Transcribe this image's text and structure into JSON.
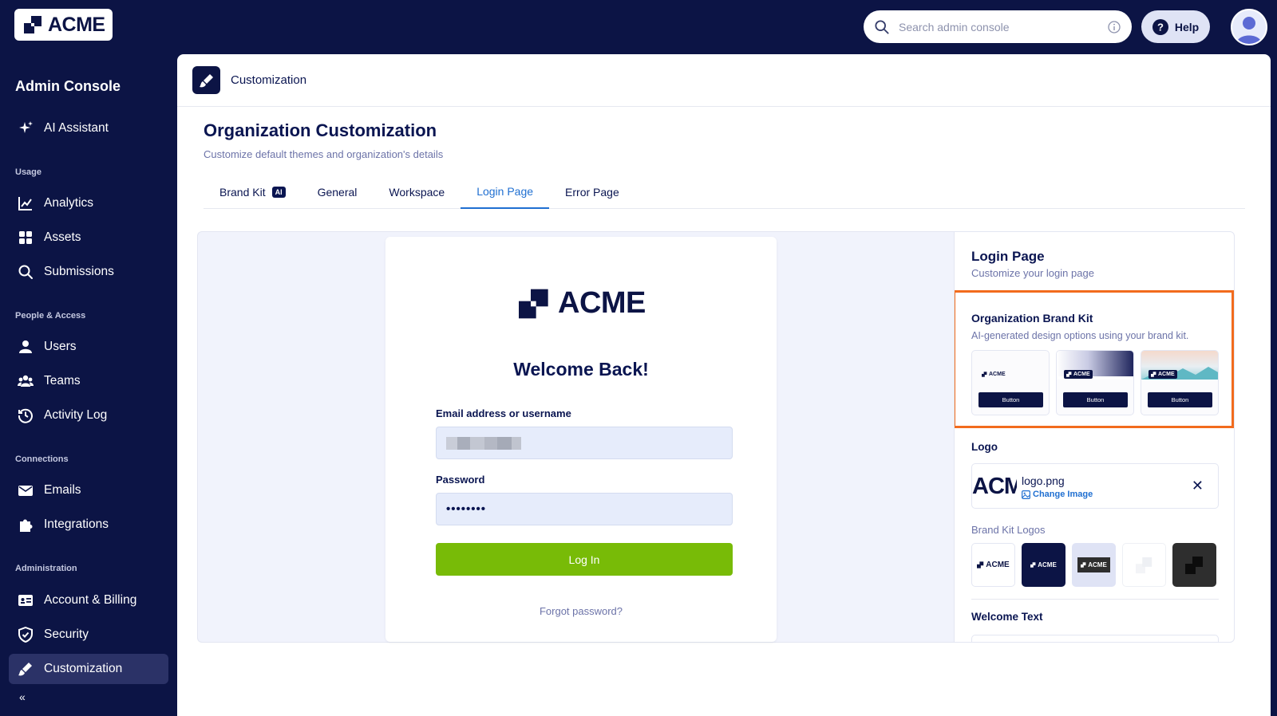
{
  "topbar": {
    "logo_text": "ACME",
    "search_placeholder": "Search admin console",
    "help_label": "Help"
  },
  "sidebar": {
    "title": "Admin Console",
    "assistant": "AI Assistant",
    "sections": {
      "usage": "Usage",
      "people": "People & Access",
      "connections": "Connections",
      "administration": "Administration"
    },
    "items": {
      "analytics": "Analytics",
      "assets": "Assets",
      "submissions": "Submissions",
      "users": "Users",
      "teams": "Teams",
      "activity_log": "Activity Log",
      "emails": "Emails",
      "integrations": "Integrations",
      "account_billing": "Account & Billing",
      "security": "Security",
      "customization": "Customization"
    }
  },
  "header": {
    "title": "Customization"
  },
  "page": {
    "title": "Organization Customization",
    "subtitle": "Customize default themes and organization's details"
  },
  "tabs": [
    {
      "label": "Brand Kit",
      "badge": "AI"
    },
    {
      "label": "General"
    },
    {
      "label": "Workspace"
    },
    {
      "label": "Login Page",
      "active": true
    },
    {
      "label": "Error Page"
    }
  ],
  "preview": {
    "logo_text": "ACME",
    "welcome": "Welcome Back!",
    "email_label": "Email address or username",
    "password_label": "Password",
    "password_value": "••••••••",
    "login_button": "Log In",
    "forgot": "Forgot password?"
  },
  "settings": {
    "title": "Login Page",
    "subtitle": "Customize your login page",
    "brand_kit": {
      "title": "Organization Brand Kit",
      "subtitle": "AI-generated design options using your brand kit.",
      "mini_logo": "ACME",
      "button_label": "Button"
    },
    "logo": {
      "label": "Logo",
      "thumb_text": "ACME",
      "filename": "logo.png",
      "change": "Change Image"
    },
    "brand_kit_logos_label": "Brand Kit Logos",
    "brand_kit_logo_text": "ACME",
    "welcome_text_label": "Welcome Text"
  },
  "colors": {
    "navy": "#0c1445",
    "accent_blue": "#1f6fd1",
    "login_green": "#78bb07",
    "highlight_orange": "#f26b1d"
  }
}
